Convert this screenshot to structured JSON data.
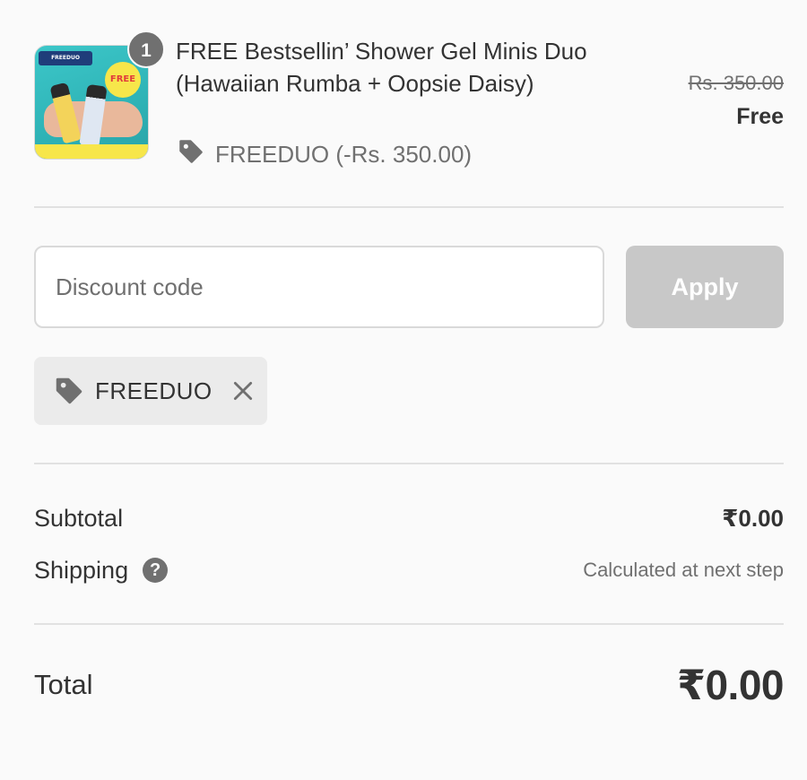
{
  "product": {
    "quantity": "1",
    "title": "FREE Bestsellin’ Shower Gel Minis Duo (Hawaiian Rumba + Oopsie Daisy)",
    "discount_note": "FREEDUO (-Rs. 350.00)",
    "original_price": "Rs. 350.00",
    "final_price": "Free",
    "image": {
      "banner_text": "FREEDUO",
      "burst_text": "FREE"
    }
  },
  "discount_form": {
    "placeholder": "Discount code",
    "value": "",
    "apply_label": "Apply"
  },
  "applied_discount": {
    "code": "FREEDUO"
  },
  "summary": {
    "subtotal_label": "Subtotal",
    "subtotal_value": "₹0.00",
    "shipping_label": "Shipping",
    "shipping_value": "Calculated at next step",
    "total_label": "Total",
    "total_value": "₹0.00"
  },
  "icons": {
    "discount": "tag-icon",
    "remove": "close-icon",
    "help": "question-circle-icon"
  },
  "colors": {
    "background": "#fafafa",
    "text": "#333333",
    "muted": "#707070",
    "apply_button_disabled": "#c8c8c8",
    "chip_background": "#ebebeb",
    "divider": "#e1e1e1"
  }
}
